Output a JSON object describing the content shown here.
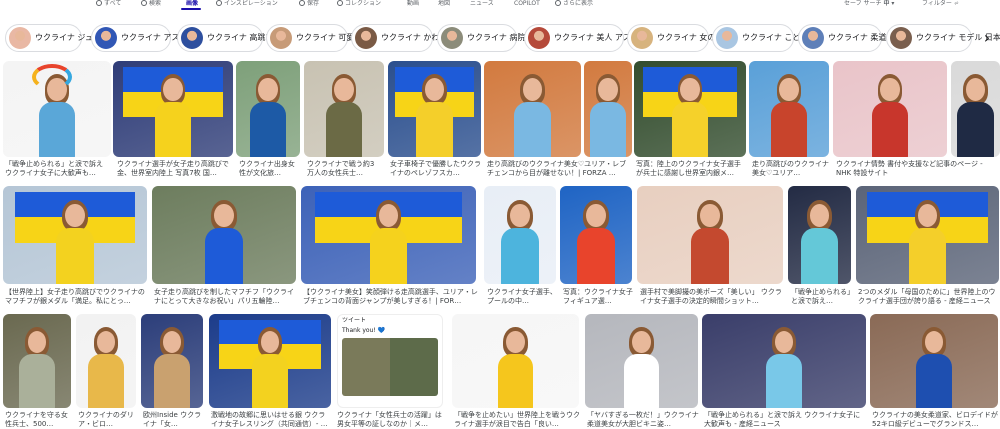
{
  "nav": {
    "tabs": [
      {
        "label": "すべて",
        "active": false,
        "icon": "search-icon"
      },
      {
        "label": "検索",
        "active": false,
        "icon": "sparkle-icon"
      },
      {
        "label": "画像",
        "active": true,
        "icon": ""
      },
      {
        "label": "インスピレーション",
        "active": false,
        "icon": "inspiration-icon"
      },
      {
        "label": "保存",
        "active": false,
        "icon": "bookmark-icon"
      },
      {
        "label": "コレクション",
        "active": false,
        "icon": "collection-icon"
      },
      {
        "label": "動画",
        "active": false,
        "icon": ""
      },
      {
        "label": "地図",
        "active": false,
        "icon": ""
      },
      {
        "label": "ニュース",
        "active": false,
        "icon": ""
      },
      {
        "label": "COPILOT",
        "active": false,
        "icon": ""
      },
      {
        "label": "さらに表示",
        "active": false,
        "icon": "more-icon"
      }
    ],
    "safe_search": "セーフ サーチ",
    "safe_search_value": "中",
    "filter": "フィルター"
  },
  "chips": [
    {
      "label": "ウクライナ ジュニア",
      "color": "#e9b8a4"
    },
    {
      "label": "ウクライナ アスリート",
      "color": "#3157b5"
    },
    {
      "label": "ウクライナ 高跳び 女子",
      "color": "#2e4f9e"
    },
    {
      "label": "ウクライナ 可愛い",
      "color": "#c79b78"
    },
    {
      "label": "ウクライナ かわいい",
      "color": "#7a5a45"
    },
    {
      "label": "ウクライナ 病院",
      "color": "#8c8c7a"
    },
    {
      "label": "ウクライナ 美人 アスリート",
      "color": "#b54a3a"
    },
    {
      "label": "ウクライナ 女の子",
      "color": "#d7b37e"
    },
    {
      "label": "ウクライナ こども",
      "color": "#a9c6e2"
    },
    {
      "label": "ウクライナ 柔道 美女",
      "color": "#5e7fb8"
    },
    {
      "label": "ウクライナ モデル 日本",
      "color": "#7a5f4e"
    }
  ],
  "images": {
    "row1": [
      {
        "caption": "「戦争止められる」と涙で訴え ウクライナ女子に大歓声も…",
        "bg": "#f4f4f4",
        "accent": "#5aa7d8"
      },
      {
        "caption": "ウクライナ選手が女子走り高跳びで金、世界室内陸上 写真7枚 国…",
        "bg": "#2f3d78",
        "accent": "#f5d21d"
      },
      {
        "caption": "ウクライナ出身女性が文化旅…",
        "bg": "#7ea07a",
        "accent": "#1d5aa6"
      },
      {
        "caption": "ウクライナで戦う約3万人の女性兵士…",
        "bg": "#c8c2b2",
        "accent": "#6b6a45"
      },
      {
        "caption": "女子車椅子で優勝したウクライナのペレゾフスカ…",
        "bg": "#2b4f8e",
        "accent": "#f4cf2a"
      },
      {
        "caption": "走り高跳びのウクライナ美女♡ユリア・レブチェンコから目が離せない！| FORZA …",
        "bg": "#d27a3f",
        "accent": "#7ab8e2"
      },
      {
        "caption": "写真：陸上のウクライナ女子選手が兵士に感謝し世界室内銀メ…",
        "bg": "#334d2e",
        "accent": "#f5d12a"
      },
      {
        "caption": "走り高跳びのウクライナ美女♡ユリア…",
        "bg": "#5aa0d8",
        "accent": "#c8442c"
      },
      {
        "caption": "ウクライナ情勢 書付や支援など記事のページ - NHK 特設サイト",
        "bg": "#e9c4c9",
        "accent": "#c8362c"
      },
      {
        "caption": "",
        "bg": "#d9d9d9",
        "accent": "#1f2a44"
      }
    ],
    "row2": [
      {
        "caption": "【世界陸上】女子走り高跳びでウクライナのマフチフが銀メダル「満足。私にとっ…",
        "bg": "#b5c6d6",
        "accent": "#f3d21f"
      },
      {
        "caption": "女子走り高跳びを制したマフチフ「ウクライナにとって大きなお祝い」パリ五輪陸…",
        "bg": "#6d7d5e",
        "accent": "#1e5bd8"
      },
      {
        "caption": "【ウクライナ美女】笑顔弾ける走高跳選手、ユリア・レブチェンコの背面ジャンプが美しすぎる！| FOR…",
        "bg": "#3d62b8",
        "accent": "#f5d21d"
      },
      {
        "caption": "ウクライナ女子選手、プールの中…",
        "bg": "#e8eef6",
        "accent": "#4db4dd"
      },
      {
        "caption": "写真：ウクライナ女子フィギュア選…",
        "bg": "#1f64c4",
        "accent": "#e8442c"
      },
      {
        "caption": "選手村で美脚撮の美ポーズ「美しい」 ウクライナ女子選手の決定的瞬間ショット…",
        "bg": "#e8cfc0",
        "accent": "#c4492f"
      },
      {
        "caption": "「戦争止められる」と涙で訴え…",
        "bg": "#232b44",
        "accent": "#64c8d8"
      },
      {
        "caption": "2つのメダル「母国のために」世界陸上のウクライナ選手団が誇り語る - 産経ニュース",
        "bg": "#5b6478",
        "accent": "#f4cf2a"
      }
    ],
    "row3": [
      {
        "caption": "ウクライナを守る女性兵士、500…",
        "bg": "#6a6950",
        "accent": "#aab09a"
      },
      {
        "caption": "ウクライナのダリア・ビロ…",
        "bg": "#f2f2f2",
        "accent": "#e8b84a"
      },
      {
        "caption": "欧州Inside ウクライナ「女…",
        "bg": "#2c3e7a",
        "accent": "#c9a16f"
      },
      {
        "caption": "激戦地の故郷に思いはせる銀 ウクライナ女子レスリング（共同通信）- …",
        "bg": "#1c3c8a",
        "accent": "#f3d21f"
      },
      {
        "caption": "ウクライナ「女性兵士の活躍」は男女平等の証しなのか｜メ…",
        "bg": "#ffffff",
        "accent": "#6b6a45"
      },
      {
        "caption": "「戦争を止めたい」世界陸上を戦うウクライナ選手が涙目で告白「良い…",
        "bg": "#f6f6f6",
        "accent": "#f5c61d"
      },
      {
        "caption": "「ヤバすぎる一枚だ！」ウクライナ柔道美女が大胆ビキニ姿…",
        "bg": "#b5b7bd",
        "accent": "#ffffff"
      },
      {
        "caption": "「戦争止められる」と涙で訴え ウクライナ女子に大歓声も - 産経ニュース",
        "bg": "#3a3e6a",
        "accent": "#79c8e8"
      },
      {
        "caption": "ウクライナの美女柔道家、ビロデイドが52キロ級デビューでグランドス…",
        "bg": "#8a6a56",
        "accent": "#1e4fb0"
      }
    ],
    "tweet_header": "ツイート",
    "tweet_text": "Thank you! 💙"
  }
}
